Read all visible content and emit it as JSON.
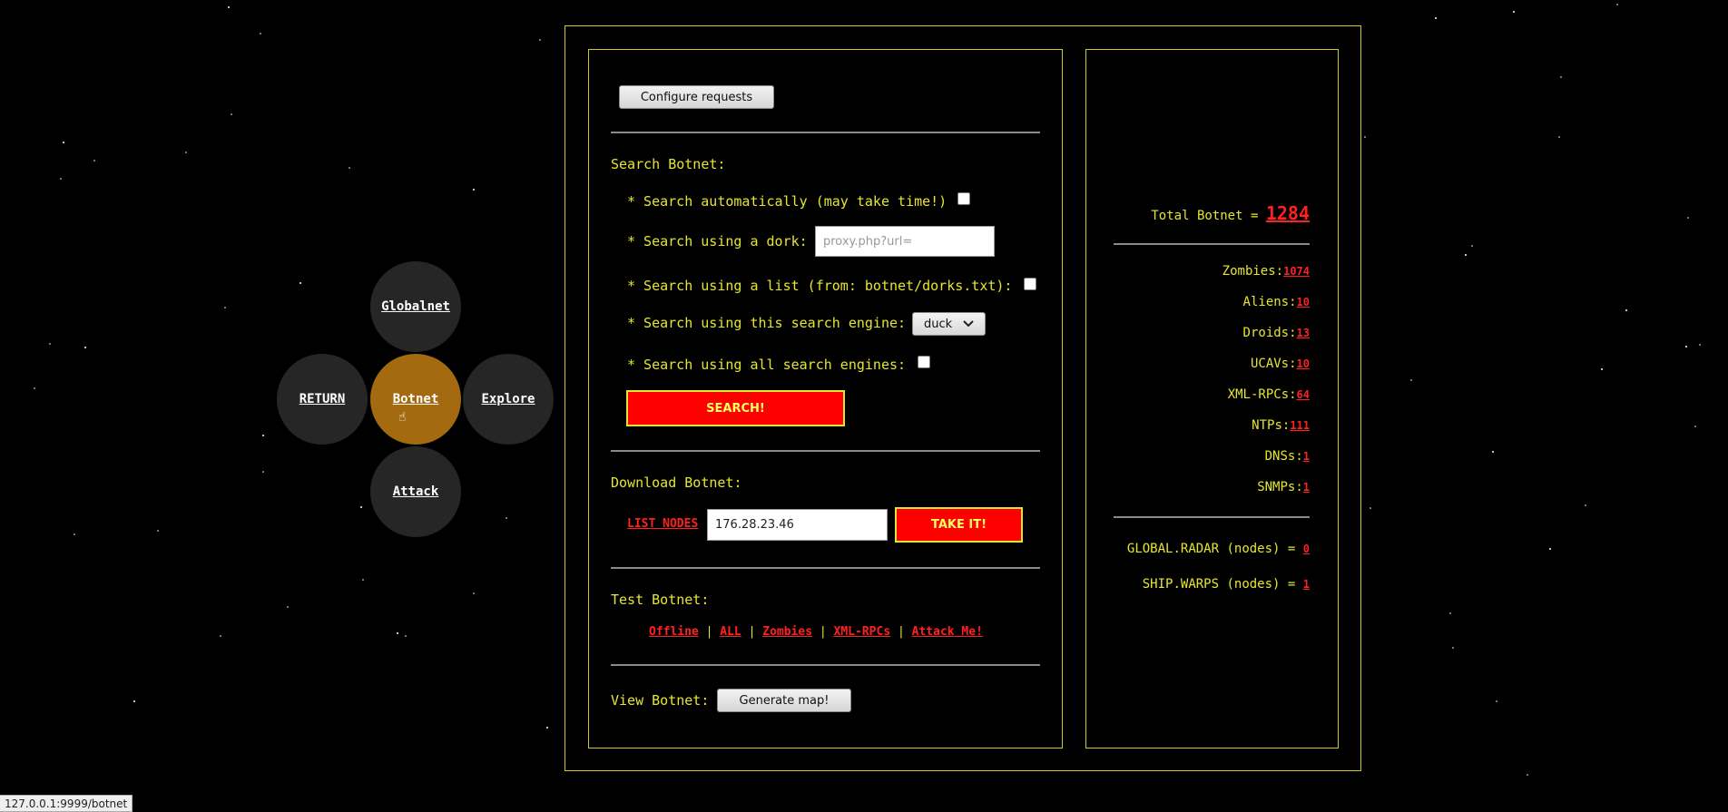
{
  "menu": {
    "globalnet": "Globalnet",
    "return": "RETURN",
    "botnet": "Botnet",
    "explore": "Explore",
    "attack": "Attack",
    "active_color": "#a36a0f"
  },
  "requests": {
    "configure_label": "Configure requests"
  },
  "search": {
    "heading": "Search Botnet:",
    "auto_label": "* Search automatically (may take time!)",
    "dork_label": "* Search using a dork:",
    "dork_placeholder": "proxy.php?url=",
    "list_label": "* Search using a list (from: botnet/dorks.txt):",
    "engine_label": "* Search using this search engine:",
    "engine_selected": "duck",
    "all_engines_label": "* Search using all search engines:",
    "search_button": "SEARCH!"
  },
  "download": {
    "heading": "Download Botnet:",
    "list_nodes": "LIST NODES",
    "ip_value": "176.28.23.46",
    "take_button": "TAKE IT!"
  },
  "test": {
    "heading": "Test Botnet:",
    "links": [
      "Offline",
      "ALL",
      "Zombies",
      "XML-RPCs",
      "Attack Me!"
    ],
    "separator": "|"
  },
  "view": {
    "heading": "View Botnet:",
    "map_button": "Generate map!"
  },
  "stats": {
    "total_label": "Total Botnet =",
    "total_value": "1284",
    "items": [
      {
        "label": "Zombies:",
        "value": "1074"
      },
      {
        "label": "Aliens:",
        "value": "10"
      },
      {
        "label": "Droids:",
        "value": "13"
      },
      {
        "label": "UCAVs:",
        "value": "10"
      },
      {
        "label": "XML-RPCs:",
        "value": "64"
      },
      {
        "label": "NTPs:",
        "value": "111"
      },
      {
        "label": "DNSs:",
        "value": "1"
      },
      {
        "label": "SNMPs:",
        "value": "1"
      }
    ],
    "radar_label": "GLOBAL.RADAR (nodes) =",
    "radar_value": "0",
    "warps_label": "SHIP.WARPS (nodes) =",
    "warps_value": "1"
  },
  "statusbar": {
    "url": "127.0.0.1:9999/botnet"
  },
  "colors": {
    "accent": "#e6e62e",
    "link": "#ff2020",
    "button_red": "#ff0000"
  }
}
